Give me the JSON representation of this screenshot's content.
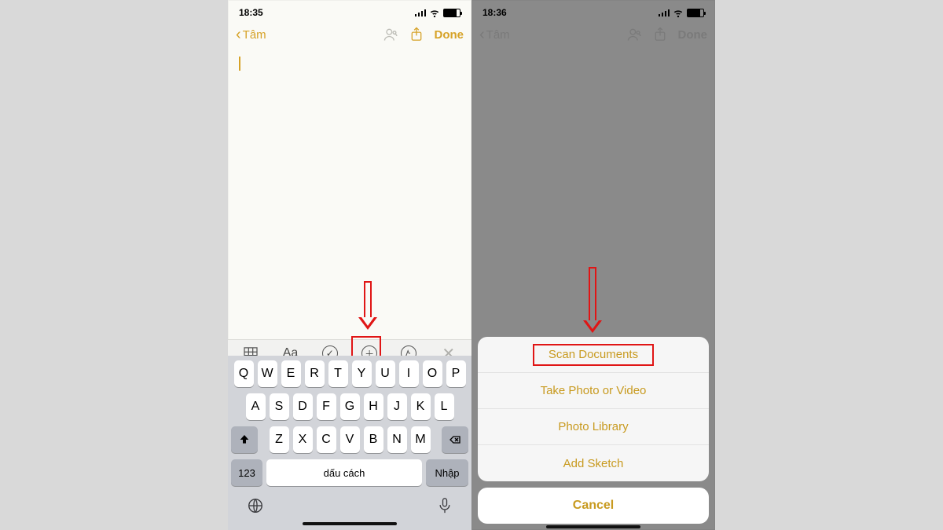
{
  "left": {
    "status_time": "18:35",
    "nav": {
      "back_label": "Tâm",
      "done_label": "Done"
    },
    "toolbar": {
      "aa_label": "Aa"
    },
    "keyboard": {
      "row1": [
        "Q",
        "W",
        "E",
        "R",
        "T",
        "Y",
        "U",
        "I",
        "O",
        "P"
      ],
      "row2": [
        "A",
        "S",
        "D",
        "F",
        "G",
        "H",
        "J",
        "K",
        "L"
      ],
      "row3": [
        "Z",
        "X",
        "C",
        "V",
        "B",
        "N",
        "M"
      ],
      "num_label": "123",
      "space_label": "dấu cách",
      "return_label": "Nhập"
    }
  },
  "right": {
    "status_time": "18:36",
    "nav": {
      "back_label": "Tâm",
      "done_label": "Done"
    },
    "sheet": {
      "options": [
        "Scan Documents",
        "Take Photo or Video",
        "Photo Library",
        "Add Sketch"
      ],
      "cancel_label": "Cancel"
    }
  }
}
